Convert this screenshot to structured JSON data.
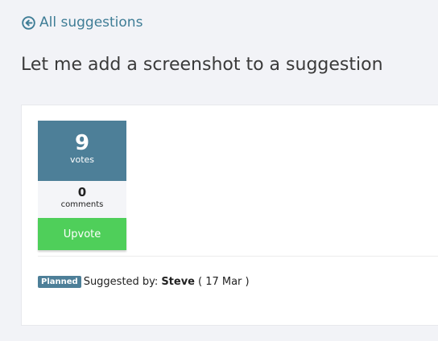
{
  "nav": {
    "back_label": "All suggestions",
    "back_icon": "circle-arrow-left-icon"
  },
  "page": {
    "title": "Let me add a screenshot to a suggestion"
  },
  "suggestion": {
    "votes_count": "9",
    "votes_label": "votes",
    "comments_count": "0",
    "comments_label": "comments",
    "upvote_label": "Upvote",
    "status": "Planned",
    "suggested_by_label": "Suggested by:",
    "author": "Steve",
    "date": "( 17 Mar )"
  },
  "colors": {
    "accent": "#4d7f98",
    "link": "#3f7d96",
    "upvote": "#4fcf5a",
    "background": "#f2f3f7"
  }
}
